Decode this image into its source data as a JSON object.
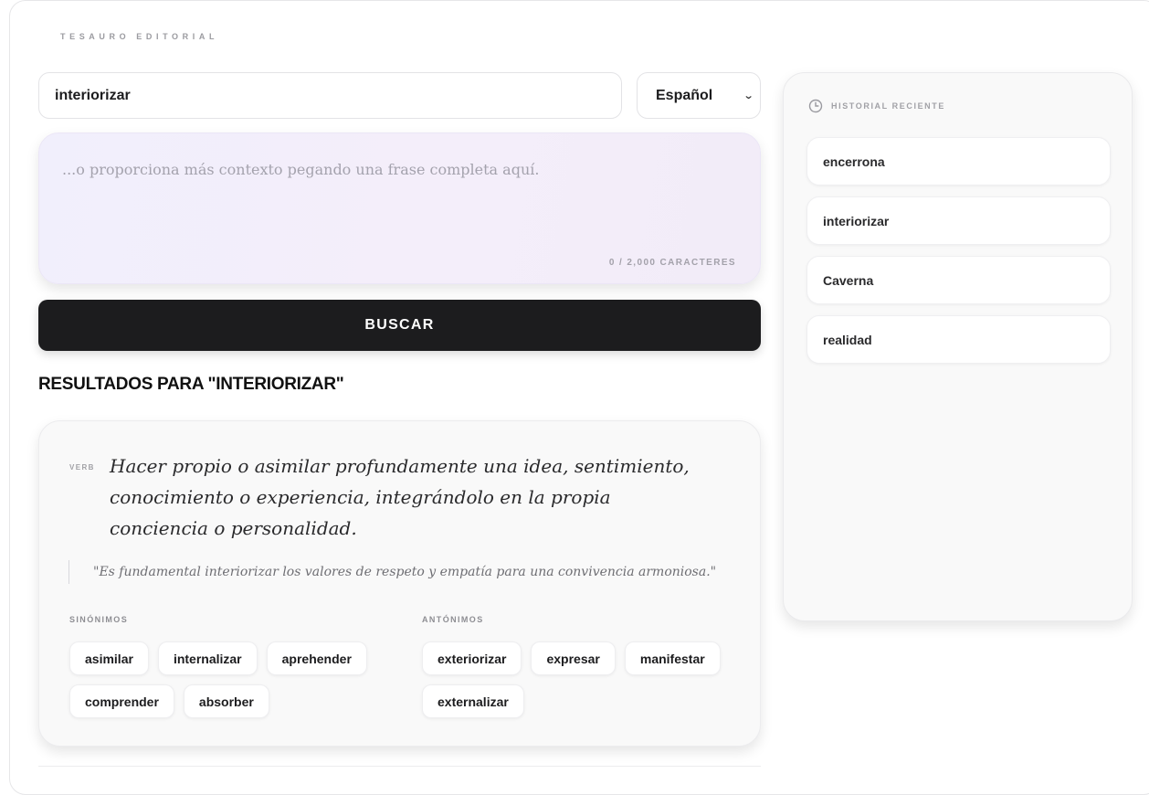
{
  "brand": "TESAURO EDITORIAL",
  "search": {
    "value": "interiorizar"
  },
  "language": {
    "selected": "Español"
  },
  "context": {
    "placeholder": "...o proporciona más contexto pegando una frase completa aquí.",
    "counter": "0 / 2,000 CARACTERES"
  },
  "search_button": "BUSCAR",
  "results": {
    "title": "RESULTADOS PARA \"INTERIORIZAR\"",
    "entries": [
      {
        "pos": "VERB",
        "definition": "Hacer propio o asimilar profundamente una idea, sentimiento, conocimiento o experiencia, integrándolo en la propia conciencia o personalidad.",
        "example": "\"Es fundamental interiorizar los valores de respeto y empatía para una convivencia armoniosa.\"",
        "synonyms_label": "SINÓNIMOS",
        "synonyms": [
          "asimilar",
          "internalizar",
          "aprehender",
          "comprender",
          "absorber"
        ],
        "antonyms_label": "ANTÓNIMOS",
        "antonyms": [
          "exteriorizar",
          "expresar",
          "manifestar",
          "externalizar"
        ]
      }
    ]
  },
  "history": {
    "icon": "clock-icon",
    "title": "HISTORIAL RECIENTE",
    "items": [
      "encerrona",
      "interiorizar",
      "Caverna",
      "realidad"
    ]
  }
}
